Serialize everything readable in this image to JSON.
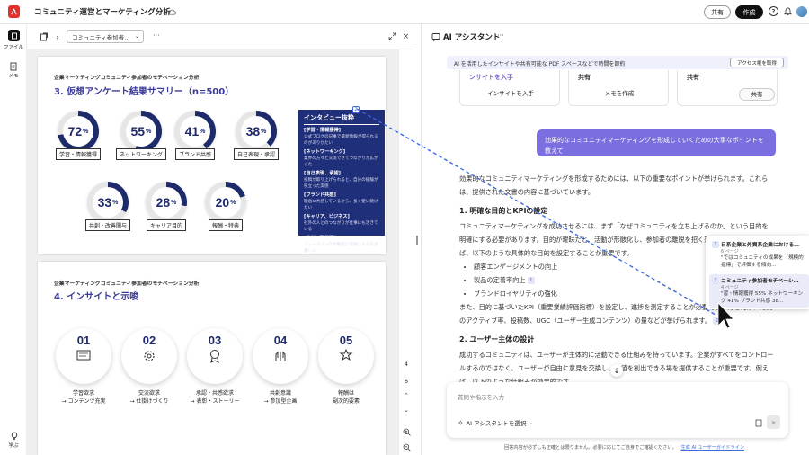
{
  "header": {
    "title": "コミュニティ運営とマーケティング分析",
    "share_label": "共有",
    "create_label": "作成"
  },
  "leftrail": {
    "files_label": "ファイル",
    "memo_label": "メモ",
    "learn_label": "学ぶ"
  },
  "doc_toolbar": {
    "doc_name": "コミュニティ参加者…",
    "menu": "···"
  },
  "page1": {
    "subtitle": "企業マーケティングコミュニティ参加者のモチベーション分析",
    "title": "3. 仮想アンケート結果サマリー（n=500）",
    "donuts": [
      {
        "value": "72",
        "pct": 72,
        "label": "学習・情報獲得"
      },
      {
        "value": "55",
        "pct": 55,
        "label": "ネットワーキング"
      },
      {
        "value": "41",
        "pct": 41,
        "label": "ブランド共感"
      },
      {
        "value": "38",
        "pct": 38,
        "label": "自己表現・承認"
      },
      {
        "value": "33",
        "pct": 33,
        "label": "共創・改善関与"
      },
      {
        "value": "28",
        "pct": 28,
        "label": "キャリア目的"
      },
      {
        "value": "20",
        "pct": 20,
        "label": "報酬・特典"
      }
    ],
    "percent_sign": "%",
    "interview": {
      "title": "インタビュー抜粋",
      "lines": [
        "[学習・情報獲得]",
        "公式ブログの記事で最新情報が得られるのがありがたい",
        "[ネットワーキング]",
        "業界の方々と交流できてつながりが広がった",
        "[自己表現、承認]",
        "投稿が取り上げられると、自分の経験が役立った実感",
        "[ブランド共感]",
        "理念に共感しているから、長く使い続けたい",
        "[キャリア、ビジネス]",
        "社外の人とのつながりが仕事にも活きている",
        "[共創、改善関与]",
        "フィードバックが製品に反映されるのが嬉しい"
      ]
    }
  },
  "page2": {
    "subtitle": "企業マーケティングコミュニティ参加者のモチベーション分析",
    "title": "4. インサイトと示唆",
    "items": [
      {
        "num": "01",
        "line1": "学習欲求",
        "line2": "→ コンテンツ充実"
      },
      {
        "num": "02",
        "line1": "交流欲求",
        "line2": "→ 仕掛けづくり"
      },
      {
        "num": "03",
        "line1": "承認・共感欲求",
        "line2": "→ 表彰・ストーリー"
      },
      {
        "num": "04",
        "line1": "共創意識",
        "line2": "→ 参加型企画"
      },
      {
        "num": "05",
        "line1": "報酬は",
        "line2": "副次的要素"
      }
    ]
  },
  "scroll": {
    "page_current": "4",
    "page_total": "6"
  },
  "ai": {
    "title": "AI アシスタント",
    "menu": "···",
    "banner_text": "AI を活用したインサイトや共有可能な PDF スペースなどで時間を節約",
    "banner_button": "アクセス権を取得",
    "cards": [
      {
        "top": "ンサイトを入手",
        "button": "インサイトを入手"
      },
      {
        "top": "共有",
        "button": "メモを作成"
      },
      {
        "top": "共有",
        "button": "共有"
      }
    ],
    "user_message": "効果的なコミュニティマーケティングを形成していくための大事なポイントを教えて",
    "answer_intro": "効果的なコミュニティマーケティングを形成するためには、以下の重要なポイントが挙げられます。これらは、提供された文書の内容に基づいています。",
    "section1_title": "1. 明確な目的とKPIの設定",
    "section1_p1": "コミュニティマーケティングを成功させるには、まず「なぜコミュニティを立ち上げるのか」という目的を明確にする必要があります。目的が曖昧だと、活動が形骸化し、参加者の離脱を招く恐れがあります。例えば、以下のような具体的な目的を設定することが重要です。",
    "bullets": [
      "顧客エンゲージメントの向上",
      "製品の定着率向上",
      "ブランドロイヤリティの強化"
    ],
    "section1_p2": "また、目的に基づいたKPI（重要業績評価指標）を設定し、進捗を測定することが必要です。たとえば、月間のアクティブ率、投稿数、UGC（ユーザー生成コンテンツ）の量などが挙げられます。",
    "section2_title": "2. ユーザー主体の設計",
    "section2_p": "成功するコミュニティは、ユーザーが主体的に活動できる仕組みを持っています。企業がすべてをコントロールするのではなく、ユーザーが自由に意見を交換し、価値を創出できる場を提供することが重要です。例えば、以下のような仕組みが効果的です。",
    "refs": [
      {
        "num": "1",
        "title": "日系企業と外資系企業における…",
        "page": "6 ページ",
        "quote": "\"ではコミュニティの成果を「規模的指標」で評価する傾向…"
      },
      {
        "num": "2",
        "title": "コミュニティ参加者モチベーシ…",
        "page": "4 ページ",
        "quote": "\"習・情報獲得 55% ネットワーキング 41% ブランド共感 38…"
      }
    ],
    "input_placeholder": "質問や指示を入力",
    "assistant_select": "AI アシスタントを選択",
    "footer_text": "回答内容が必ずしも正確とは限りません。必要に応じてご自身でご確認ください。",
    "footer_link": "生成 AI ユーザーガイドライン"
  },
  "colors": {
    "navy": "#1e2b6b",
    "accent": "#3a3a9a",
    "brand_red": "#e0312b",
    "user_bubble": "#7b6ee0",
    "link": "#3d6be0"
  }
}
